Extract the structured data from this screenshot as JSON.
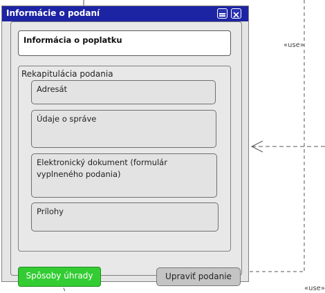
{
  "window": {
    "title": "Informácie o podaní"
  },
  "panel": {
    "fee_info": "Informácia o poplatku",
    "recap": {
      "label": "Rekapitulácia podania",
      "items": [
        "Adresát",
        "Údaje o správe",
        "Elektronický dokument (formulár vyplneného podania)",
        "Prílohy"
      ]
    },
    "payment_button": "Spôsoby úhrady",
    "edit_button": "Upraviť podanie"
  },
  "connectors": {
    "use_top": "«use»",
    "use_bottom": "«use»"
  },
  "colors": {
    "titlebar": "#1d24a3",
    "payment_button": "#33cc33",
    "edit_button": "#c4c4c4"
  }
}
